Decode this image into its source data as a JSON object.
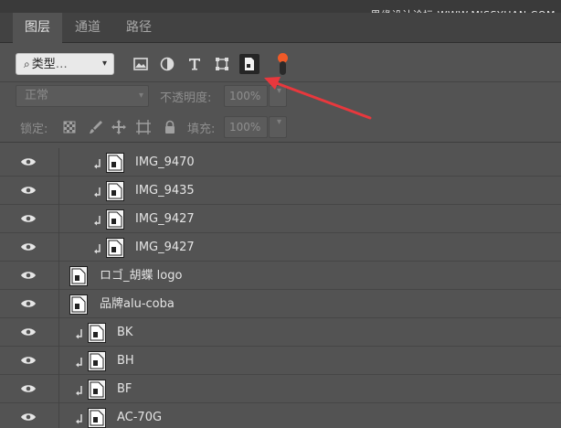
{
  "watermark": "思缘设计论坛 WWW.MISSYUAN.COM",
  "tabs": [
    {
      "label": "图层",
      "active": true
    },
    {
      "label": "通道",
      "active": false
    },
    {
      "label": "路径",
      "active": false
    }
  ],
  "filter": {
    "kind_label": "类型",
    "icons": [
      "image-filter-icon",
      "adjustment-filter-icon",
      "type-filter-icon",
      "shape-filter-icon",
      "smart-object-filter-icon"
    ],
    "active_icon": "smart-object-filter-icon",
    "toggle_color": "#f05a28"
  },
  "blend": {
    "mode": "正常",
    "opacity_label": "不透明度:",
    "opacity_value": "100%"
  },
  "lock": {
    "label": "锁定:",
    "icons": [
      "lock-transparent-icon",
      "lock-image-icon",
      "lock-position-icon",
      "lock-artboard-icon",
      "lock-all-icon"
    ],
    "fill_label": "填充:",
    "fill_value": "100%"
  },
  "layers": [
    {
      "name": "IMG_9470",
      "clipped": true,
      "visible": true
    },
    {
      "name": "IMG_9435",
      "clipped": true,
      "visible": true
    },
    {
      "name": "IMG_9427",
      "clipped": true,
      "visible": true
    },
    {
      "name": "IMG_9427",
      "clipped": true,
      "visible": true
    },
    {
      "name": "ロゴ_胡蝶 logo",
      "clipped": false,
      "visible": true
    },
    {
      "name": "品牌alu-coba",
      "clipped": false,
      "visible": true
    },
    {
      "name": "BK",
      "clipped": true,
      "visible": true
    },
    {
      "name": "BH",
      "clipped": true,
      "visible": true
    },
    {
      "name": "BF",
      "clipped": true,
      "visible": true
    },
    {
      "name": "AC-70G",
      "clipped": true,
      "visible": true
    }
  ],
  "colors": {
    "panel": "#535353",
    "annotation_arrow": "#e8383d",
    "toggle": "#f05a28"
  }
}
